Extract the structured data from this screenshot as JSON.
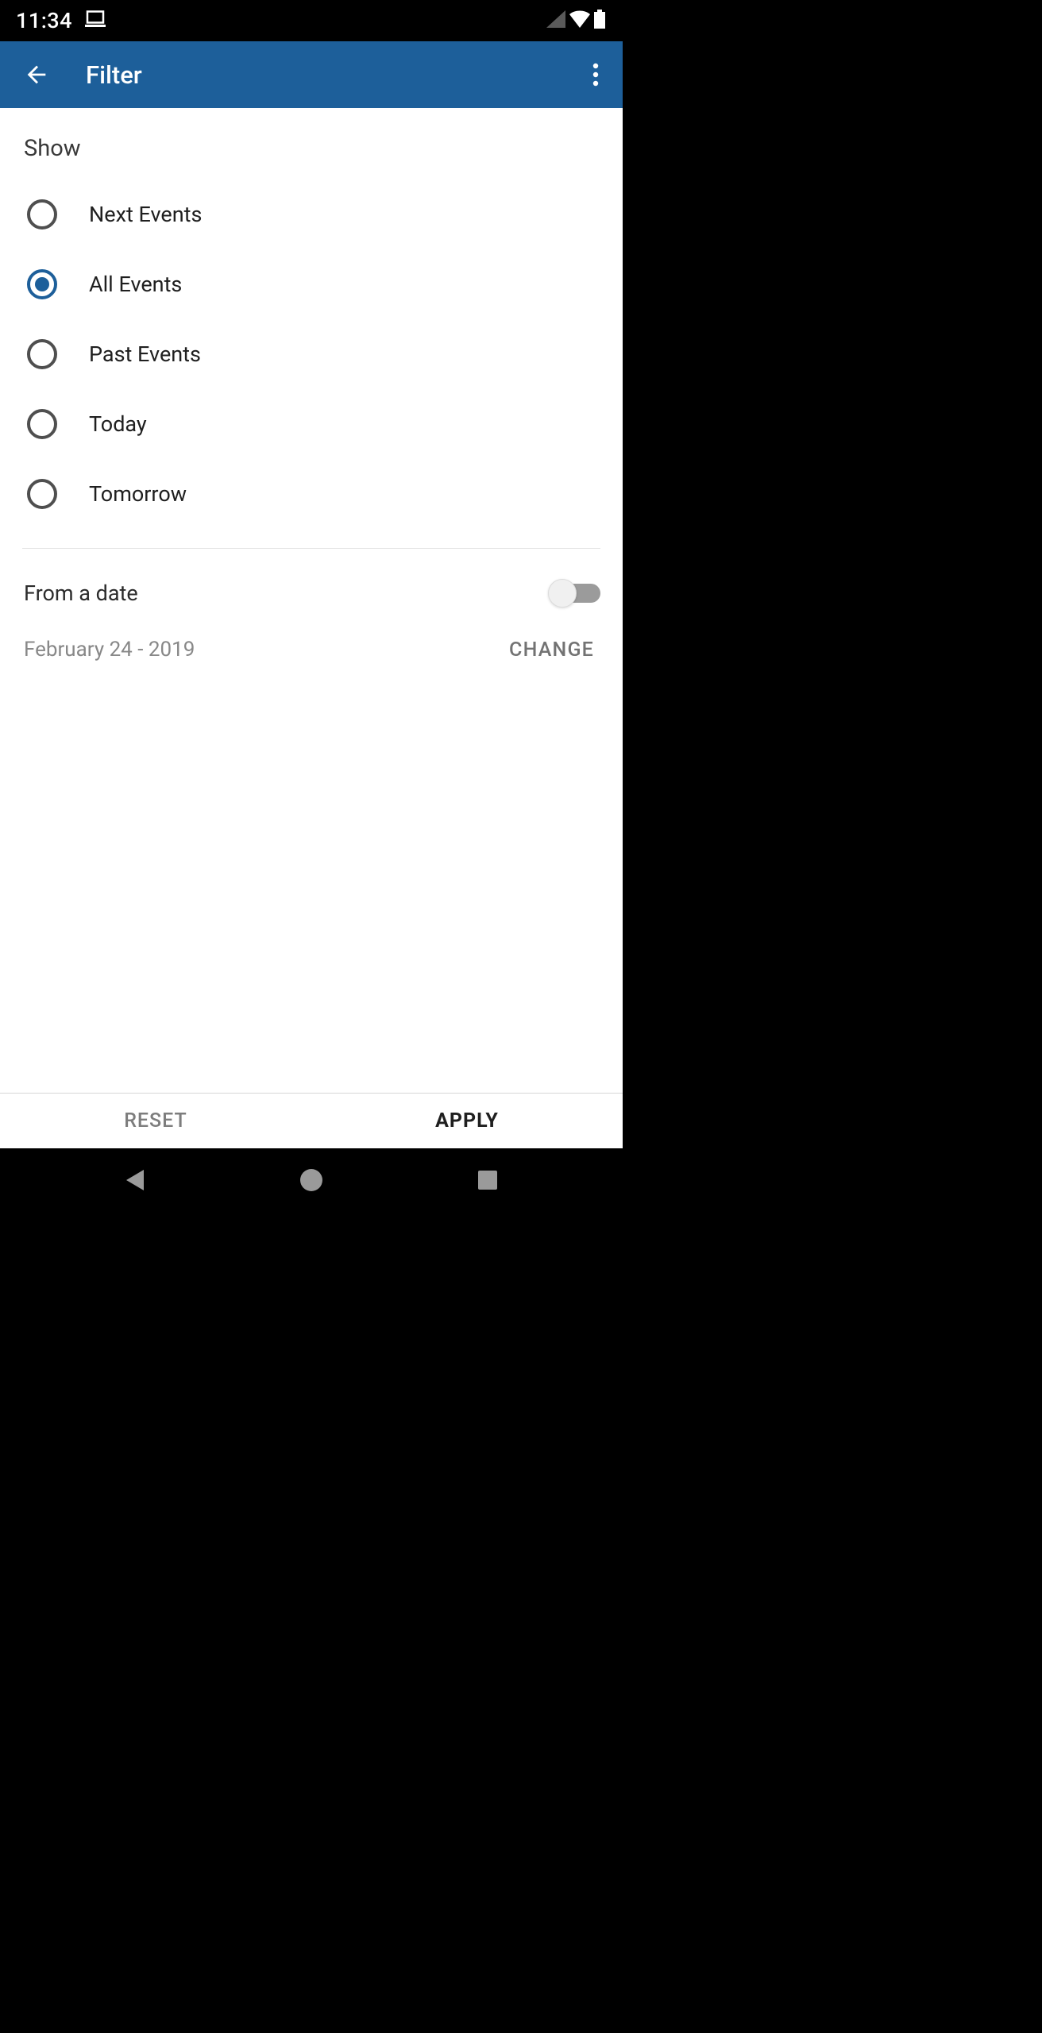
{
  "status": {
    "time": "11:34"
  },
  "appbar": {
    "title": "Filter"
  },
  "section": {
    "title": "Show"
  },
  "options": [
    {
      "label": "Next Events",
      "selected": false
    },
    {
      "label": "All Events",
      "selected": true
    },
    {
      "label": "Past Events",
      "selected": false
    },
    {
      "label": "Today",
      "selected": false
    },
    {
      "label": "Tomorrow",
      "selected": false
    }
  ],
  "fromDate": {
    "label": "From a date",
    "enabled": false,
    "value": "February 24 - 2019",
    "changeLabel": "CHANGE"
  },
  "actions": {
    "reset": "RESET",
    "apply": "APPLY"
  }
}
